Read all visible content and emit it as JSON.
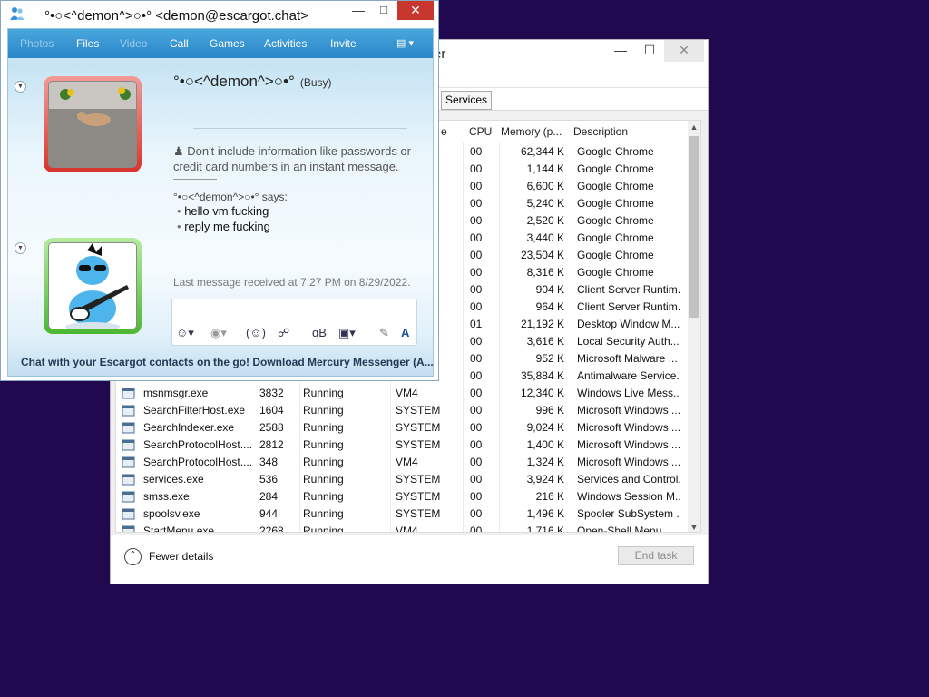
{
  "taskmanager": {
    "title": "er",
    "tab_services": "Services",
    "columns": {
      "partial": "e",
      "cpu": "CPU",
      "memory": "Memory (p...",
      "description": "Description"
    },
    "top_rows": [
      {
        "cpu": "00",
        "mem": "62,344 K",
        "desc": "Google Chrome"
      },
      {
        "cpu": "00",
        "mem": "1,144 K",
        "desc": "Google Chrome"
      },
      {
        "cpu": "00",
        "mem": "6,600 K",
        "desc": "Google Chrome"
      },
      {
        "cpu": "00",
        "mem": "5,240 K",
        "desc": "Google Chrome"
      },
      {
        "cpu": "00",
        "mem": "2,520 K",
        "desc": "Google Chrome"
      },
      {
        "cpu": "00",
        "mem": "3,440 K",
        "desc": "Google Chrome"
      },
      {
        "cpu": "00",
        "mem": "23,504 K",
        "desc": "Google Chrome"
      },
      {
        "cpu": "00",
        "mem": "8,316 K",
        "desc": "Google Chrome"
      },
      {
        "cpu": "00",
        "mem": "904 K",
        "desc": "Client Server Runtim..."
      },
      {
        "cpu": "00",
        "mem": "964 K",
        "desc": "Client Server Runtim..."
      },
      {
        "cpu": "01",
        "mem": "21,192 K",
        "desc": "Desktop Window M..."
      },
      {
        "cpu": "00",
        "mem": "3,616 K",
        "desc": "Local Security Auth..."
      },
      {
        "cpu": "00",
        "mem": "952 K",
        "desc": "Microsoft Malware ..."
      },
      {
        "cpu": "00",
        "mem": "35,884 K",
        "desc": "Antimalware Service..."
      }
    ],
    "rows": [
      {
        "name": "msnmsgr.exe",
        "pid": "3832",
        "status": "Running",
        "user": "VM4",
        "cpu": "00",
        "mem": "12,340 K",
        "desc": "Windows Live Mess..."
      },
      {
        "name": "SearchFilterHost.exe",
        "pid": "1604",
        "status": "Running",
        "user": "SYSTEM",
        "cpu": "00",
        "mem": "996 K",
        "desc": "Microsoft Windows ..."
      },
      {
        "name": "SearchIndexer.exe",
        "pid": "2588",
        "status": "Running",
        "user": "SYSTEM",
        "cpu": "00",
        "mem": "9,024 K",
        "desc": "Microsoft Windows ..."
      },
      {
        "name": "SearchProtocolHost....",
        "pid": "2812",
        "status": "Running",
        "user": "SYSTEM",
        "cpu": "00",
        "mem": "1,400 K",
        "desc": "Microsoft Windows ..."
      },
      {
        "name": "SearchProtocolHost....",
        "pid": "348",
        "status": "Running",
        "user": "VM4",
        "cpu": "00",
        "mem": "1,324 K",
        "desc": "Microsoft Windows ..."
      },
      {
        "name": "services.exe",
        "pid": "536",
        "status": "Running",
        "user": "SYSTEM",
        "cpu": "00",
        "mem": "3,924 K",
        "desc": "Services and Control..."
      },
      {
        "name": "smss.exe",
        "pid": "284",
        "status": "Running",
        "user": "SYSTEM",
        "cpu": "00",
        "mem": "216 K",
        "desc": "Windows Session M..."
      },
      {
        "name": "spoolsv.exe",
        "pid": "944",
        "status": "Running",
        "user": "SYSTEM",
        "cpu": "00",
        "mem": "1,496 K",
        "desc": "Spooler SubSystem ..."
      },
      {
        "name": "StartMenu.exe",
        "pid": "2268",
        "status": "Running",
        "user": "VM4",
        "cpu": "00",
        "mem": "1,716 K",
        "desc": "Open-Shell Menu"
      }
    ],
    "fewer_details": "Fewer details",
    "end_task": "End task"
  },
  "messenger": {
    "title": "°•○<^demon^>○•° <demon@escargot.chat>",
    "nav": [
      "Photos",
      "Files",
      "Video",
      "Call",
      "Games",
      "Activities",
      "Invite"
    ],
    "contact_name": "°•○<^demon^>○•°",
    "contact_status": "(Busy)",
    "warning": "Don't include information like passwords or credit card numbers in an instant message.",
    "says": "°•○<^demon^>○•° says:",
    "messages": [
      "hello vm fucking",
      "reply me fucking"
    ],
    "last_message": "Last message received at 7:27 PM on 8/29/2022.",
    "footer": "Chat with your Escargot contacts on the go! Download Mercury Messenger (A...",
    "colors": {
      "close": "#c7372e",
      "nav": "#2a86c8",
      "contact_frame": "#e0524c",
      "self_frame": "#5fc249",
      "desktop": "#20094f"
    }
  }
}
